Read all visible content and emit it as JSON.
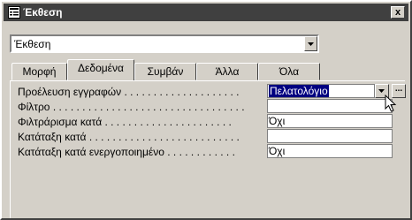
{
  "window": {
    "title": "Έκθεση",
    "close_label": "x"
  },
  "object_selector": {
    "value": "Έκθεση"
  },
  "tabs": [
    {
      "label": "Μορφή",
      "active": false
    },
    {
      "label": "Δεδομένα",
      "active": true
    },
    {
      "label": "Συμβάν",
      "active": false
    },
    {
      "label": "Άλλα",
      "active": false
    },
    {
      "label": "Όλα",
      "active": false
    }
  ],
  "properties": [
    {
      "label": "Προέλευση εγγραφών . . . . . . . . . . . . . . . . . . . .",
      "value": "Πελατολόγιο"
    },
    {
      "label": "Φίλτρο . . . . . . . . . . . . . . . . . . . . . . . . . . . . . . . . .",
      "value": ""
    },
    {
      "label": "Φιλτράρισμα κατά . . . . . . . . . . . . . . . . . . . . . .",
      "value": "Όχι"
    },
    {
      "label": "Κατάταξη κατά . . . . . . . . . . . . . . . . . . . . . . . . . .",
      "value": ""
    },
    {
      "label": "Κατάταξη κατά ενεργοποιημένο . . . . . . . . . . . .",
      "value": "Όχι"
    }
  ],
  "builder_label": "..."
}
